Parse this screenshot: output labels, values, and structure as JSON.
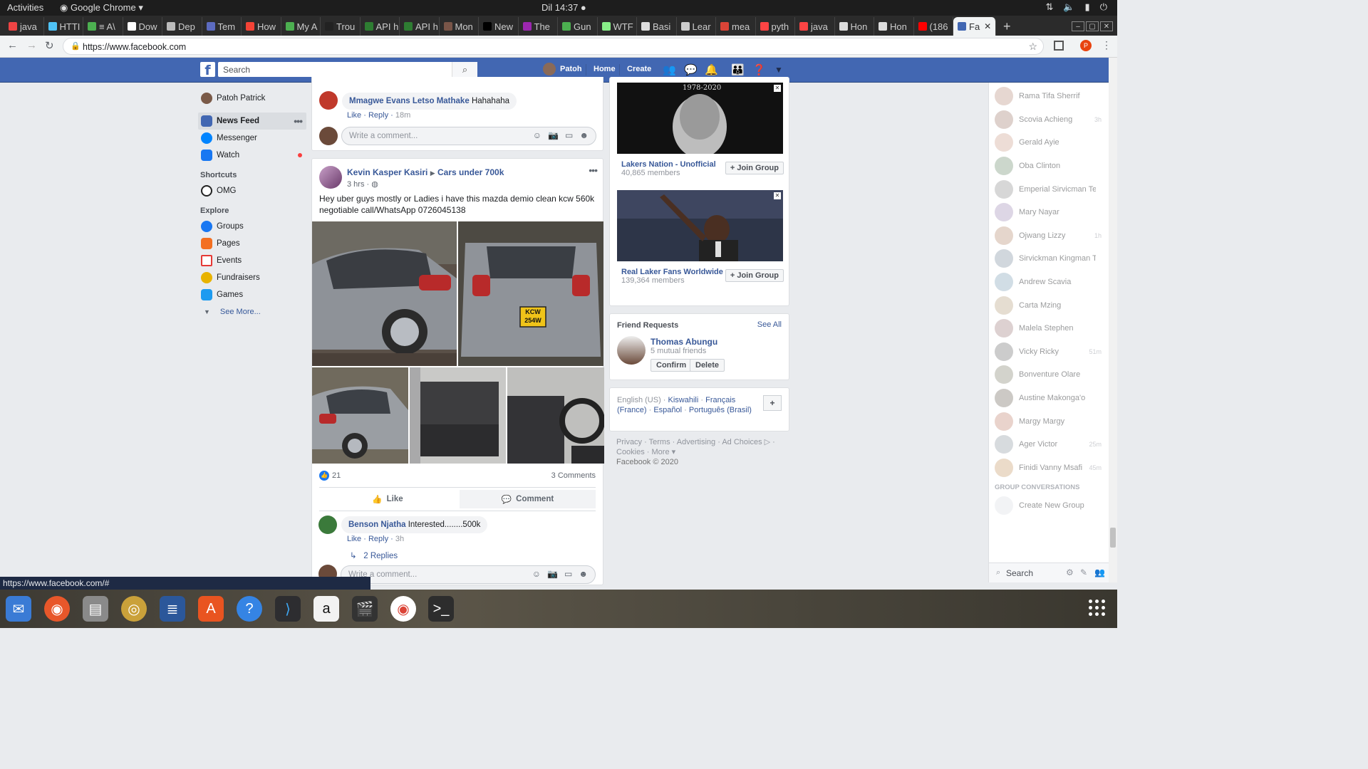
{
  "os": {
    "activities": "Activities",
    "app_menu": "Google Chrome ▾",
    "clock": "Dil 14:37 ●",
    "tray_icons": [
      "network-icon",
      "volume-icon",
      "battery-icon",
      "power-icon"
    ]
  },
  "browser": {
    "tabs": [
      "java",
      "HTTI",
      "≡ A\\",
      "Dow",
      "Dep",
      "Tem",
      "How",
      "My A",
      "Trou",
      "API h",
      "API h",
      "Mon",
      "New",
      "The",
      "Gun",
      "WTF",
      "Basi",
      "Lear",
      "mea",
      "pyth",
      "java",
      "Hon",
      "Hon",
      "(186"
    ],
    "active_tab": "Fa",
    "url": "https://www.facebook.com",
    "profile_letter": "P",
    "status_url": "https://www.facebook.com/#"
  },
  "fb": {
    "search_placeholder": "Search",
    "nav": {
      "user": "Patoh",
      "home": "Home",
      "create": "Create"
    }
  },
  "leftnav": {
    "profile": "Patoh Patrick",
    "items": [
      {
        "label": "News Feed",
        "color": "#4267b2"
      },
      {
        "label": "Messenger",
        "color": "#0084ff"
      },
      {
        "label": "Watch",
        "color": "#1877f2"
      }
    ],
    "shortcuts_head": "Shortcuts",
    "shortcuts": [
      {
        "label": "OMG"
      }
    ],
    "explore_head": "Explore",
    "explore": [
      {
        "label": "Groups",
        "color": "#1877f2"
      },
      {
        "label": "Pages",
        "color": "#f36f21"
      },
      {
        "label": "Events",
        "color": "#e53935"
      },
      {
        "label": "Fundraisers",
        "color": "#e8b300"
      },
      {
        "label": "Games",
        "color": "#1d9bf0"
      }
    ],
    "see_more": "See More..."
  },
  "feed": {
    "prev_comment": {
      "author": "Mmagwe Evans Letso Mathake",
      "text": "Hahahaha",
      "like": "Like",
      "reply": "Reply",
      "time": "18m"
    },
    "write_placeholder": "Write a comment...",
    "post": {
      "author": "Kevin Kasper Kasiri",
      "group": "Cars under 700k",
      "time": "3 hrs",
      "text": "Hey uber guys mostly or Ladies i have this mazda demio clean kcw 560k negotiable call/WhatsApp 0726045138",
      "plate_top": "KCW",
      "plate_bottom": "254W",
      "reactions": "21",
      "comments_count": "3 Comments",
      "like_label": "Like",
      "comment_label": "Comment"
    },
    "comment": {
      "author": "Benson Njatha",
      "text": "Interested........500k",
      "like": "Like",
      "reply": "Reply",
      "time": "3h",
      "replies": "2 Replies"
    }
  },
  "right": {
    "ad1": {
      "caption": "1978-2020",
      "title": "Lakers Nation - Unofficial",
      "members": "40,865 members",
      "join": "Join Group"
    },
    "ad2": {
      "title": "Real Laker Fans Worldwide",
      "members": "139,364 members",
      "join": "Join Group"
    },
    "friend_requests": {
      "title": "Friend Requests",
      "see_all": "See All",
      "name": "Thomas Abungu",
      "mutual": "5 mutual friends",
      "confirm": "Confirm",
      "delete": "Delete"
    },
    "languages": {
      "current": "English (US) ·",
      "l1": "Kiswahili",
      "l2": "Français (France)",
      "l3": "Español",
      "l4": "Português (Brasil)"
    },
    "footer": {
      "line1": "Privacy · Terms · Advertising · Ad Choices ▷ ·",
      "line2": "Cookies · More ▾",
      "copyright": "Facebook © 2020"
    }
  },
  "chat": {
    "contacts": [
      {
        "name": "Rama Tifa Sherrif",
        "time": ""
      },
      {
        "name": "Scovia Achieng",
        "time": "3h"
      },
      {
        "name": "Gerald Ayie",
        "time": ""
      },
      {
        "name": "Oba Clinton",
        "time": ""
      },
      {
        "name": "Emperial Sirvicman Telo",
        "time": ""
      },
      {
        "name": "Mary Nayar",
        "time": ""
      },
      {
        "name": "Ojwang Lizzy",
        "time": "1h"
      },
      {
        "name": "Sirvickman Kingman Telo",
        "time": ""
      },
      {
        "name": "Andrew Scavia",
        "time": ""
      },
      {
        "name": "Carta Mzing",
        "time": ""
      },
      {
        "name": "Malela Stephen",
        "time": ""
      },
      {
        "name": "Vicky Ricky",
        "time": "51m"
      },
      {
        "name": "Bonventure Olare",
        "time": ""
      },
      {
        "name": "Austine Makonga'o",
        "time": ""
      },
      {
        "name": "Margy Margy",
        "time": ""
      },
      {
        "name": "Ager Victor",
        "time": "25m"
      },
      {
        "name": "Finidi Vanny Msafi",
        "time": "45m"
      }
    ],
    "group_head": "GROUP CONVERSATIONS",
    "create_group": "Create New Group",
    "search": "Search"
  }
}
